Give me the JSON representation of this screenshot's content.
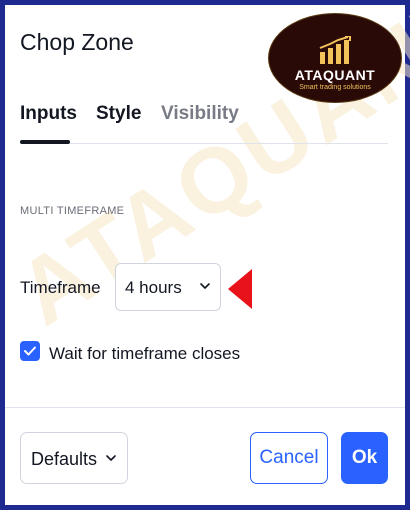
{
  "dialog": {
    "title": "Chop Zone"
  },
  "logo": {
    "name": "ATAQUANT",
    "tagline": "Smart trading solutions"
  },
  "watermark": "ATAQUANT",
  "tabs": [
    {
      "label": "Inputs",
      "active": true
    },
    {
      "label": "Style",
      "active": false
    },
    {
      "label": "Visibility",
      "active": false
    }
  ],
  "section": {
    "title": "MULTI TIMEFRAME"
  },
  "timeframe": {
    "label": "Timeframe",
    "value": "4 hours"
  },
  "wait_close": {
    "label": "Wait for timeframe closes",
    "checked": true
  },
  "footer": {
    "defaults_label": "Defaults",
    "cancel_label": "Cancel",
    "ok_label": "Ok"
  },
  "colors": {
    "accent": "#2962ff",
    "frame": "#1e2a8f",
    "arrow": "#e8121a",
    "logo_bg": "#2a0a07",
    "logo_gold": "#f3c25a"
  }
}
